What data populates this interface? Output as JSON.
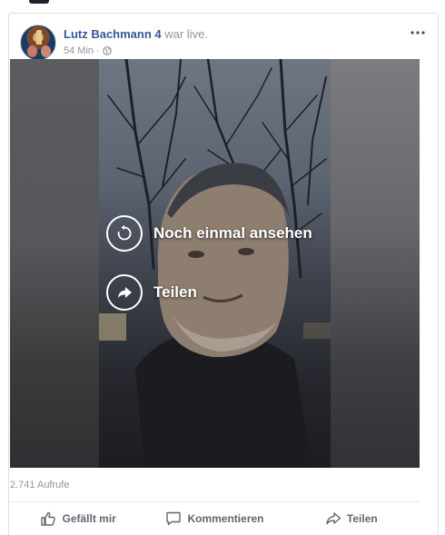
{
  "post": {
    "author": "Lutz Bachmann 4",
    "action": "war live.",
    "time": "54 Min",
    "separator": "·",
    "privacy_icon": "globe-icon",
    "more_icon": "more-options-icon"
  },
  "video": {
    "replay_label": "Noch einmal ansehen",
    "share_label": "Teilen",
    "replay_icon": "replay-icon",
    "share_icon": "share-arrow-icon"
  },
  "stats": {
    "views": "2.741 Aufrufe"
  },
  "actions": {
    "like_label": "Gefällt mir",
    "comment_label": "Kommentieren",
    "share_label": "Teilen"
  },
  "colors": {
    "link": "#365899",
    "muted": "#90949c",
    "action": "#606770"
  }
}
